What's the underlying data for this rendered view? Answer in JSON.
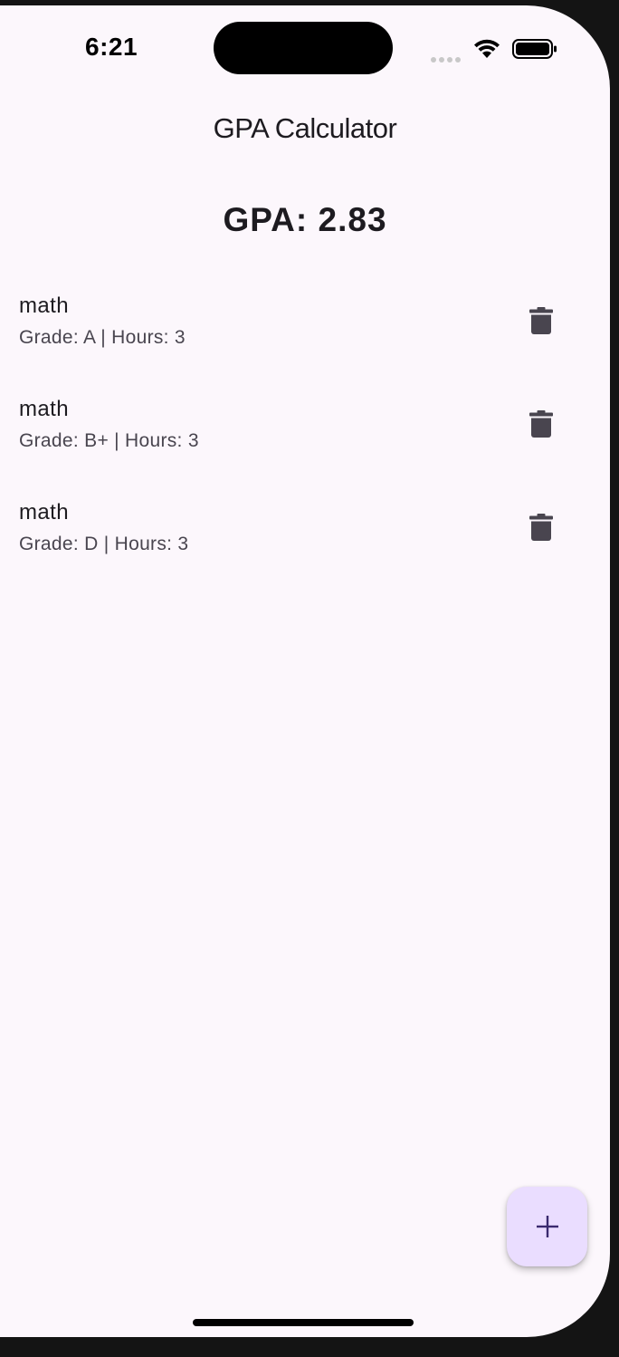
{
  "status_bar": {
    "time": "6:21",
    "icons": [
      "signal-dots-icon",
      "wifi-icon",
      "battery-icon"
    ]
  },
  "app": {
    "title": "GPA Calculator",
    "gpa_text": "GPA: 2.83"
  },
  "courses": [
    {
      "name": "math",
      "details": "Grade: A | Hours: 3",
      "delete_icon": "trash-icon"
    },
    {
      "name": "math",
      "details": "Grade: B+ | Hours: 3",
      "delete_icon": "trash-icon"
    },
    {
      "name": "math",
      "details": "Grade: D | Hours: 3",
      "delete_icon": "trash-icon"
    }
  ],
  "fab": {
    "icon": "plus-icon"
  },
  "colors": {
    "background": "#fcf7fc",
    "fab_background": "#eaddff",
    "fab_icon": "#3a2a6e",
    "icon_gray": "#49454f",
    "text_primary": "#1d1b20"
  }
}
